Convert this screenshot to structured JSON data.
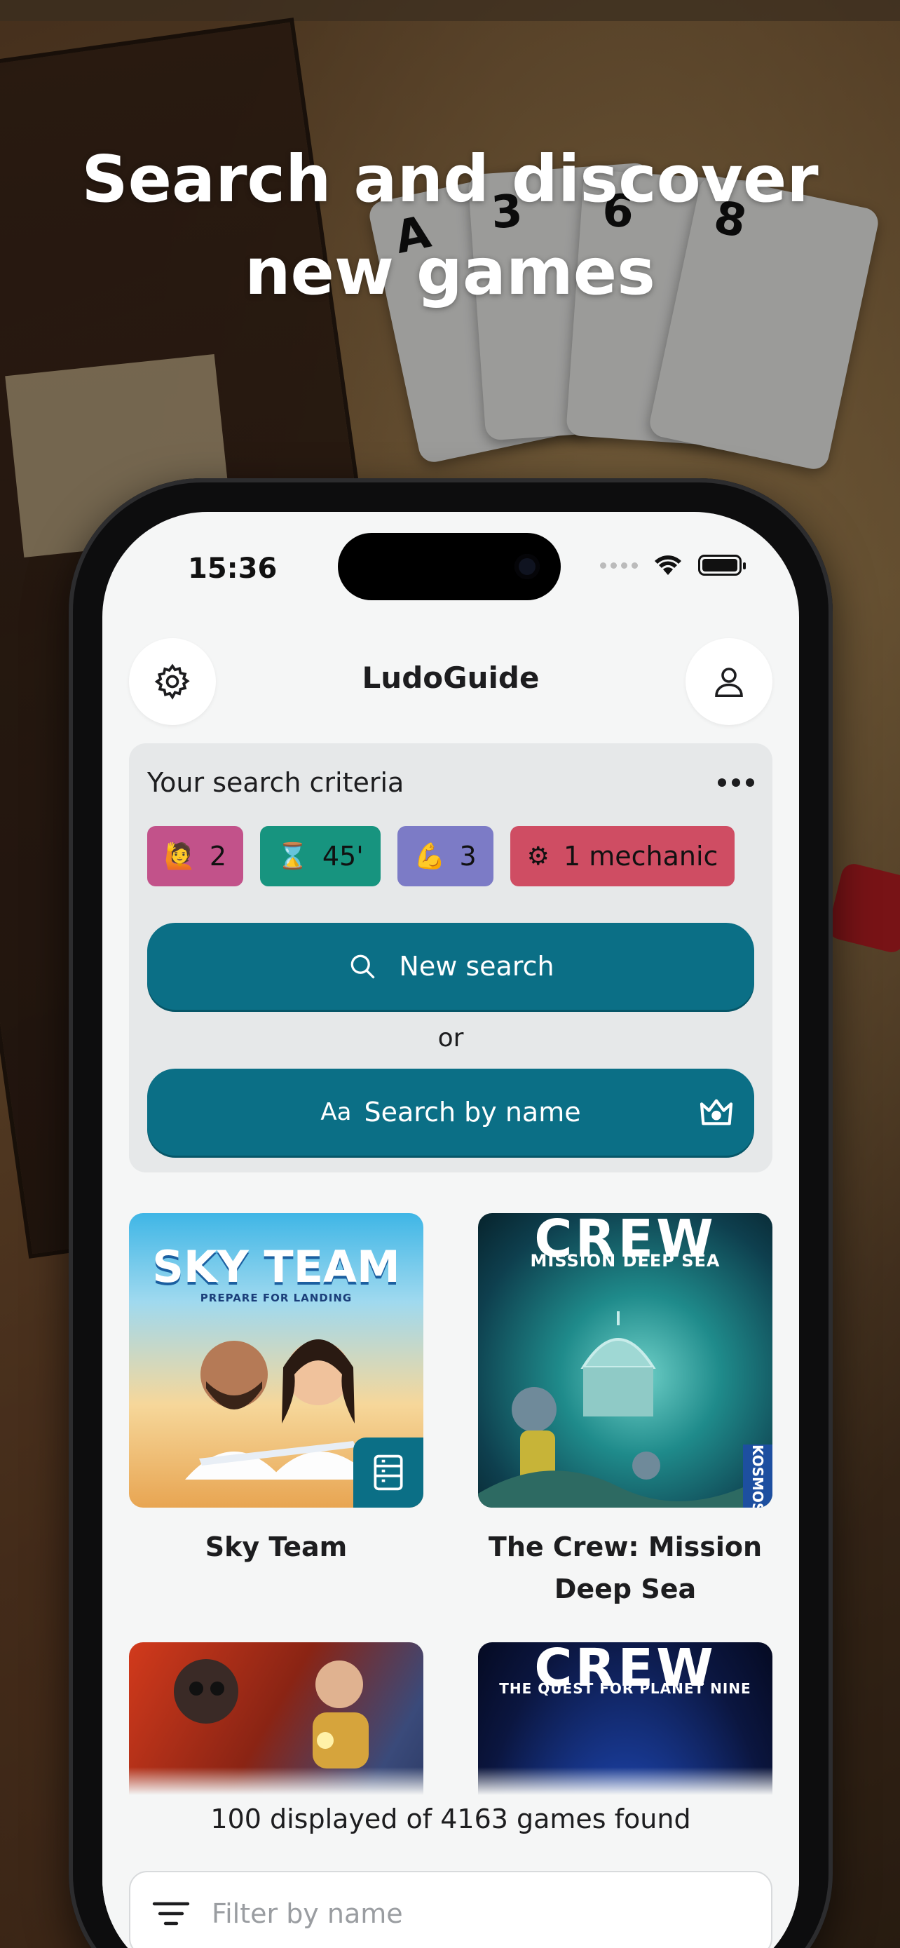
{
  "headline": "Search and discover new games",
  "status": {
    "time": "15:36",
    "battery_level": 1.0
  },
  "app": {
    "title": "LudoGuide"
  },
  "criteria": {
    "title": "Your search criteria",
    "chips": [
      {
        "icon": "player-icon",
        "glyph": "🙋",
        "value": "2",
        "color": "#c2528a"
      },
      {
        "icon": "hourglass-icon",
        "glyph": "⌛",
        "value": "45'",
        "color": "#17947f"
      },
      {
        "icon": "muscle-icon",
        "glyph": "💪",
        "value": "3",
        "color": "#7c7bc6"
      },
      {
        "icon": "gear-icon",
        "glyph": "⚙",
        "value": "1 mechanic",
        "color": "#cf4d63"
      }
    ],
    "new_search_label": "New search",
    "or_label": "or",
    "search_by_name_prefix": "Aa",
    "search_by_name_label": "Search by name"
  },
  "games": [
    {
      "title": "Sky Team",
      "cover_title": "SKY TEAM",
      "cover_subtitle": "PREPARE FOR LANDING"
    },
    {
      "title": "The Crew: Mission Deep Sea",
      "cover_title": "CREW",
      "cover_subtitle": "MISSION DEEP SEA",
      "publisher": "KOSMOS"
    },
    {
      "title": "",
      "cover_title": ""
    },
    {
      "title": "",
      "cover_title": "CREW",
      "cover_subtitle": "THE QUEST FOR PLANET NINE"
    }
  ],
  "results": {
    "count_text": "100 displayed of 4163 games found"
  },
  "filter": {
    "placeholder": "Filter by name"
  }
}
